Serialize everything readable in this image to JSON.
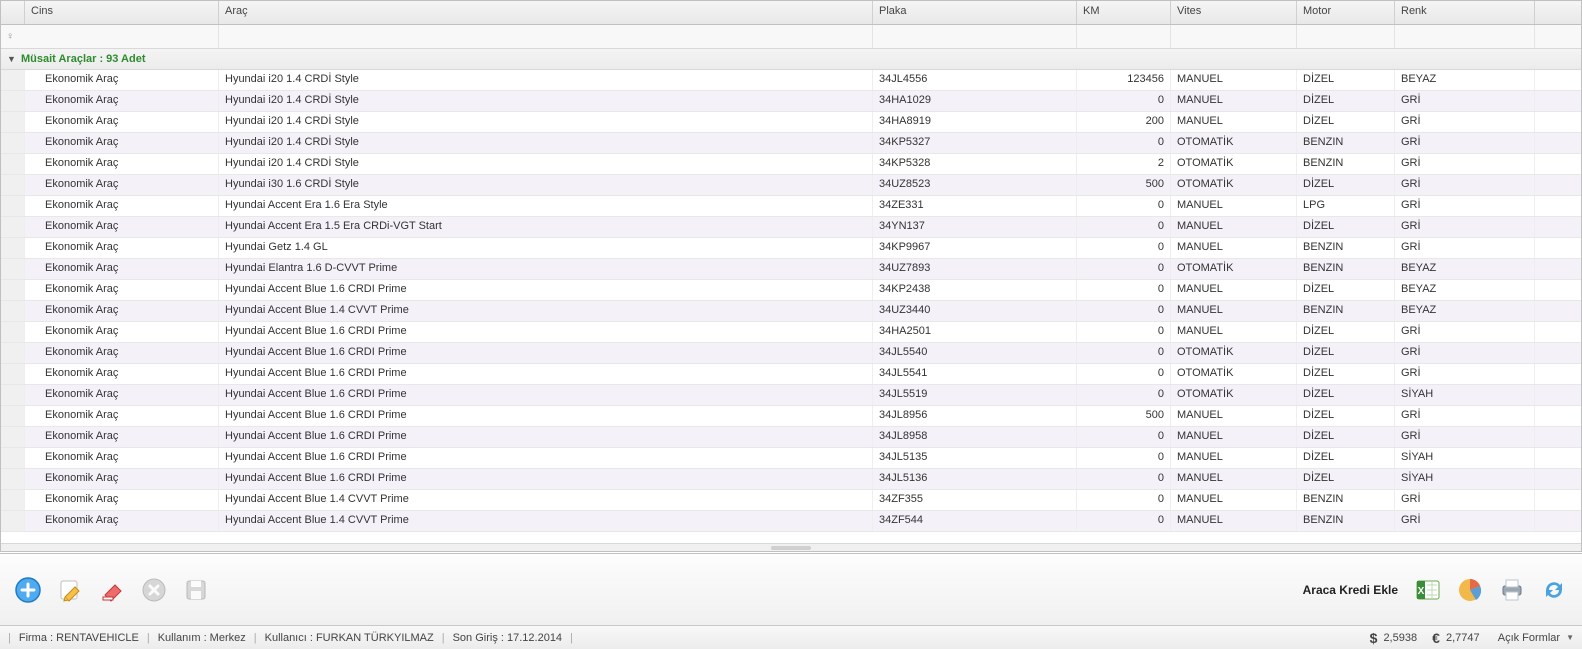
{
  "columns": {
    "cins": "Cins",
    "arac": "Araç",
    "plaka": "Plaka",
    "km": "KM",
    "vites": "Vites",
    "motor": "Motor",
    "renk": "Renk"
  },
  "group_header": "Müsait Araçlar : 93 Adet",
  "rows": [
    {
      "cins": "Ekonomik Araç",
      "arac": "Hyundai i20 1.4 CRDİ Style",
      "plaka": "34JL4556",
      "km": "123456",
      "vites": "MANUEL",
      "motor": "DİZEL",
      "renk": "BEYAZ"
    },
    {
      "cins": "Ekonomik Araç",
      "arac": "Hyundai i20 1.4 CRDİ Style",
      "plaka": "34HA1029",
      "km": "0",
      "vites": "MANUEL",
      "motor": "DİZEL",
      "renk": "GRİ"
    },
    {
      "cins": "Ekonomik Araç",
      "arac": "Hyundai i20 1.4 CRDİ Style",
      "plaka": "34HA8919",
      "km": "200",
      "vites": "MANUEL",
      "motor": "DİZEL",
      "renk": "GRİ"
    },
    {
      "cins": "Ekonomik Araç",
      "arac": "Hyundai i20 1.4 CRDİ Style",
      "plaka": "34KP5327",
      "km": "0",
      "vites": "OTOMATİK",
      "motor": "BENZIN",
      "renk": "GRİ"
    },
    {
      "cins": "Ekonomik Araç",
      "arac": "Hyundai i20 1.4 CRDİ Style",
      "plaka": "34KP5328",
      "km": "2",
      "vites": "OTOMATİK",
      "motor": "BENZIN",
      "renk": "GRİ"
    },
    {
      "cins": "Ekonomik Araç",
      "arac": "Hyundai i30 1.6 CRDİ Style",
      "plaka": "34UZ8523",
      "km": "500",
      "vites": "OTOMATİK",
      "motor": "DİZEL",
      "renk": "GRİ"
    },
    {
      "cins": "Ekonomik Araç",
      "arac": "Hyundai Accent Era 1.6 Era Style",
      "plaka": "34ZE331",
      "km": "0",
      "vites": "MANUEL",
      "motor": "LPG",
      "renk": "GRİ"
    },
    {
      "cins": "Ekonomik Araç",
      "arac": "Hyundai Accent Era 1.5 Era CRDi-VGT Start",
      "plaka": "34YN137",
      "km": "0",
      "vites": "MANUEL",
      "motor": "DİZEL",
      "renk": "GRİ"
    },
    {
      "cins": "Ekonomik Araç",
      "arac": "Hyundai Getz 1.4 GL",
      "plaka": "34KP9967",
      "km": "0",
      "vites": "MANUEL",
      "motor": "BENZIN",
      "renk": "GRİ"
    },
    {
      "cins": "Ekonomik Araç",
      "arac": "Hyundai Elantra 1.6 D-CVVT Prime",
      "plaka": "34UZ7893",
      "km": "0",
      "vites": "OTOMATİK",
      "motor": "BENZIN",
      "renk": "BEYAZ"
    },
    {
      "cins": "Ekonomik Araç",
      "arac": "Hyundai Accent Blue 1.6 CRDI Prime",
      "plaka": "34KP2438",
      "km": "0",
      "vites": "MANUEL",
      "motor": "DİZEL",
      "renk": "BEYAZ"
    },
    {
      "cins": "Ekonomik Araç",
      "arac": "Hyundai Accent Blue 1.4 CVVT Prime",
      "plaka": "34UZ3440",
      "km": "0",
      "vites": "MANUEL",
      "motor": "BENZIN",
      "renk": "BEYAZ"
    },
    {
      "cins": "Ekonomik Araç",
      "arac": "Hyundai Accent Blue 1.6 CRDI Prime",
      "plaka": "34HA2501",
      "km": "0",
      "vites": "MANUEL",
      "motor": "DİZEL",
      "renk": "GRİ"
    },
    {
      "cins": "Ekonomik Araç",
      "arac": "Hyundai Accent Blue 1.6 CRDI Prime",
      "plaka": "34JL5540",
      "km": "0",
      "vites": "OTOMATİK",
      "motor": "DİZEL",
      "renk": "GRİ"
    },
    {
      "cins": "Ekonomik Araç",
      "arac": "Hyundai Accent Blue 1.6 CRDI Prime",
      "plaka": "34JL5541",
      "km": "0",
      "vites": "OTOMATİK",
      "motor": "DİZEL",
      "renk": "GRİ"
    },
    {
      "cins": "Ekonomik Araç",
      "arac": "Hyundai Accent Blue 1.6 CRDI Prime",
      "plaka": "34JL5519",
      "km": "0",
      "vites": "OTOMATİK",
      "motor": "DİZEL",
      "renk": "SİYAH"
    },
    {
      "cins": "Ekonomik Araç",
      "arac": "Hyundai Accent Blue 1.6 CRDI Prime",
      "plaka": "34JL8956",
      "km": "500",
      "vites": "MANUEL",
      "motor": "DİZEL",
      "renk": "GRİ"
    },
    {
      "cins": "Ekonomik Araç",
      "arac": "Hyundai Accent Blue 1.6 CRDI Prime",
      "plaka": "34JL8958",
      "km": "0",
      "vites": "MANUEL",
      "motor": "DİZEL",
      "renk": "GRİ"
    },
    {
      "cins": "Ekonomik Araç",
      "arac": "Hyundai Accent Blue 1.6 CRDI Prime",
      "plaka": "34JL5135",
      "km": "0",
      "vites": "MANUEL",
      "motor": "DİZEL",
      "renk": "SİYAH"
    },
    {
      "cins": "Ekonomik Araç",
      "arac": "Hyundai Accent Blue 1.6 CRDI Prime",
      "plaka": "34JL5136",
      "km": "0",
      "vites": "MANUEL",
      "motor": "DİZEL",
      "renk": "SİYAH"
    },
    {
      "cins": "Ekonomik Araç",
      "arac": "Hyundai Accent Blue 1.4 CVVT Prime",
      "plaka": "34ZF355",
      "km": "0",
      "vites": "MANUEL",
      "motor": "BENZIN",
      "renk": "GRİ"
    },
    {
      "cins": "Ekonomik Araç",
      "arac": "Hyundai Accent Blue 1.4 CVVT Prime",
      "plaka": "34ZF544",
      "km": "0",
      "vites": "MANUEL",
      "motor": "BENZIN",
      "renk": "GRİ"
    }
  ],
  "toolbar": {
    "credit_label": "Araca Kredi Ekle"
  },
  "status": {
    "firma": "Firma : RENTAVEHICLE",
    "kullanim": "Kullanım : Merkez",
    "kullanici": "Kullanıcı : FURKAN TÜRKYILMAZ",
    "songiris": "Son Giriş : 17.12.2014",
    "usd": "2,5938",
    "eur": "2,7747",
    "acik_formlar": "Açık Formlar"
  }
}
